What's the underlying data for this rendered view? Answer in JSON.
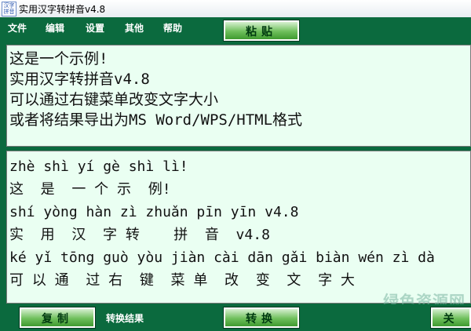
{
  "window": {
    "title": "实用汉字转拼音v4.8",
    "icon_text": "汉字拼音"
  },
  "menu": {
    "items": [
      "文件",
      "编辑",
      "设置",
      "其他",
      "帮助"
    ],
    "paste_button": "粘贴"
  },
  "source_text": {
    "lines": [
      "这是一个示例!",
      "实用汉字转拼音v4.8",
      "可以通过右键菜单改变文字大小",
      "或者将结果导出为MS Word/WPS/HTML格式"
    ]
  },
  "result_text": {
    "lines": [
      "zhè shì yí gè shì lì!",
      "这  是  一 个 示  例!",
      "shí yòng hàn zì zhuǎn pīn yīn v4.8",
      "实  用  汉  字 转    拼  音  v4.8",
      "ké yǐ tōng guò yòu jiàn cài dān gǎi biàn wén zì dà",
      "可 以 通  过 右  键  菜 单  改  变  文  字 大"
    ]
  },
  "bottom": {
    "copy_button": "复制",
    "label": "转换结果",
    "convert_button": "转换",
    "close_button": "关"
  },
  "watermark": "绿色资源网"
}
